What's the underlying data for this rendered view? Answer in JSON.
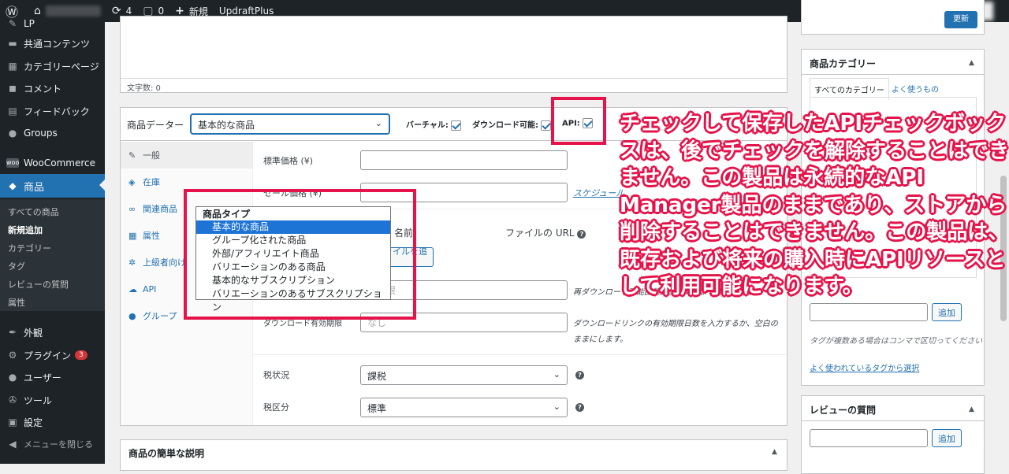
{
  "adminbar": {
    "updates_count": "4",
    "comments_count": "0",
    "new_label": "新規",
    "plugin_label": "UpdraftPlus"
  },
  "sidebar": {
    "items": [
      {
        "label": "LP",
        "icon": "pin-icon"
      },
      {
        "label": "共通コンテンツ",
        "icon": "folder-icon"
      },
      {
        "label": "カテゴリーページ",
        "icon": "page-icon"
      },
      {
        "label": "コメント",
        "icon": "comment-icon"
      },
      {
        "label": "フィードバック",
        "icon": "feedback-icon"
      },
      {
        "label": "Groups",
        "icon": "groups-icon"
      },
      {
        "label": "WooCommerce",
        "icon": "woo-icon"
      },
      {
        "label": "商品",
        "icon": "box-icon"
      }
    ],
    "submenu": [
      "すべての商品",
      "新規追加",
      "カテゴリー",
      "タグ",
      "レビューの質問",
      "属性"
    ],
    "bottom_items": [
      {
        "label": "外観",
        "icon": "brush-icon"
      },
      {
        "label": "プラグイン",
        "icon": "plugin-icon",
        "badge": "3"
      },
      {
        "label": "ユーザー",
        "icon": "user-icon"
      },
      {
        "label": "ツール",
        "icon": "wrench-icon"
      },
      {
        "label": "設定",
        "icon": "settings-icon"
      },
      {
        "label": "メニューを閉じる",
        "icon": "collapse-icon"
      }
    ]
  },
  "editor": {
    "word_count": "文字数: 0"
  },
  "product_data": {
    "title": "商品データー",
    "type_selected": "基本的な商品",
    "virtual_label": "バーチャル:",
    "download_label": "ダウンロード可能:",
    "api_label": "API:",
    "tabs": [
      {
        "label": "一般",
        "icon": "wrench-icon"
      },
      {
        "label": "在庫",
        "icon": "tag-icon"
      },
      {
        "label": "関連商品",
        "icon": "link-icon"
      },
      {
        "label": "属性",
        "icon": "list-icon"
      },
      {
        "label": "上級者向け",
        "icon": "gear-icon"
      },
      {
        "label": "API",
        "icon": "cloud-icon"
      },
      {
        "label": "グループ",
        "icon": "groups-icon"
      }
    ],
    "regular_price_label": "標準価格 (¥)",
    "sale_price_label": "セール価格 (¥)",
    "schedule_link": "スケジュール",
    "file_name_label": "名前",
    "file_url_label": "ファイルの URL",
    "add_file_button": "ファイルを追加",
    "download_limit_placeholder": "無制限",
    "download_limit_help": "再ダウンロード可能回数。空欄のままで無制限になります。",
    "download_expiry_label": "ダウンロード有効期限",
    "download_expiry_placeholder": "なし",
    "download_expiry_help": "ダウンロードリンクの有効期限日数を入力するか、空白のままにします。",
    "tax_status_label": "税状況",
    "tax_status_value": "課税",
    "tax_class_label": "税区分",
    "tax_class_value": "標準"
  },
  "dropdown": {
    "group_label": "商品タイプ",
    "options": [
      "基本的な商品",
      "グループ化された商品",
      "外部/アフィリエイト商品",
      "バリエーションのある商品",
      "基本的なサブスクリプション",
      "バリエーションのあるサブスクリプション"
    ],
    "selected_index": 0
  },
  "short_desc": {
    "title": "商品の簡単な説明"
  },
  "right": {
    "update_button": "更新",
    "category_title": "商品カテゴリー",
    "cat_tab_all": "すべてのカテゴリー",
    "cat_tab_popular": "よく使うもの",
    "tag_add_button": "追加",
    "tag_hint": "タグが複数ある場合はコンマで区切ってください",
    "tag_popular_link": "よく使われているタグから選択",
    "review_title": "レビューの質問",
    "review_add_button": "追加"
  },
  "annotation": {
    "text": "チェックして保存したAPIチェックボックスは、後でチェックを解除することはできません。この製品は永続的なAPI Manager製品のままであり、ストアから削除することはできません。この製品は、既存および将来の購入時にAPIリソースとして利用可能になります。",
    "color": "#e4144a"
  }
}
